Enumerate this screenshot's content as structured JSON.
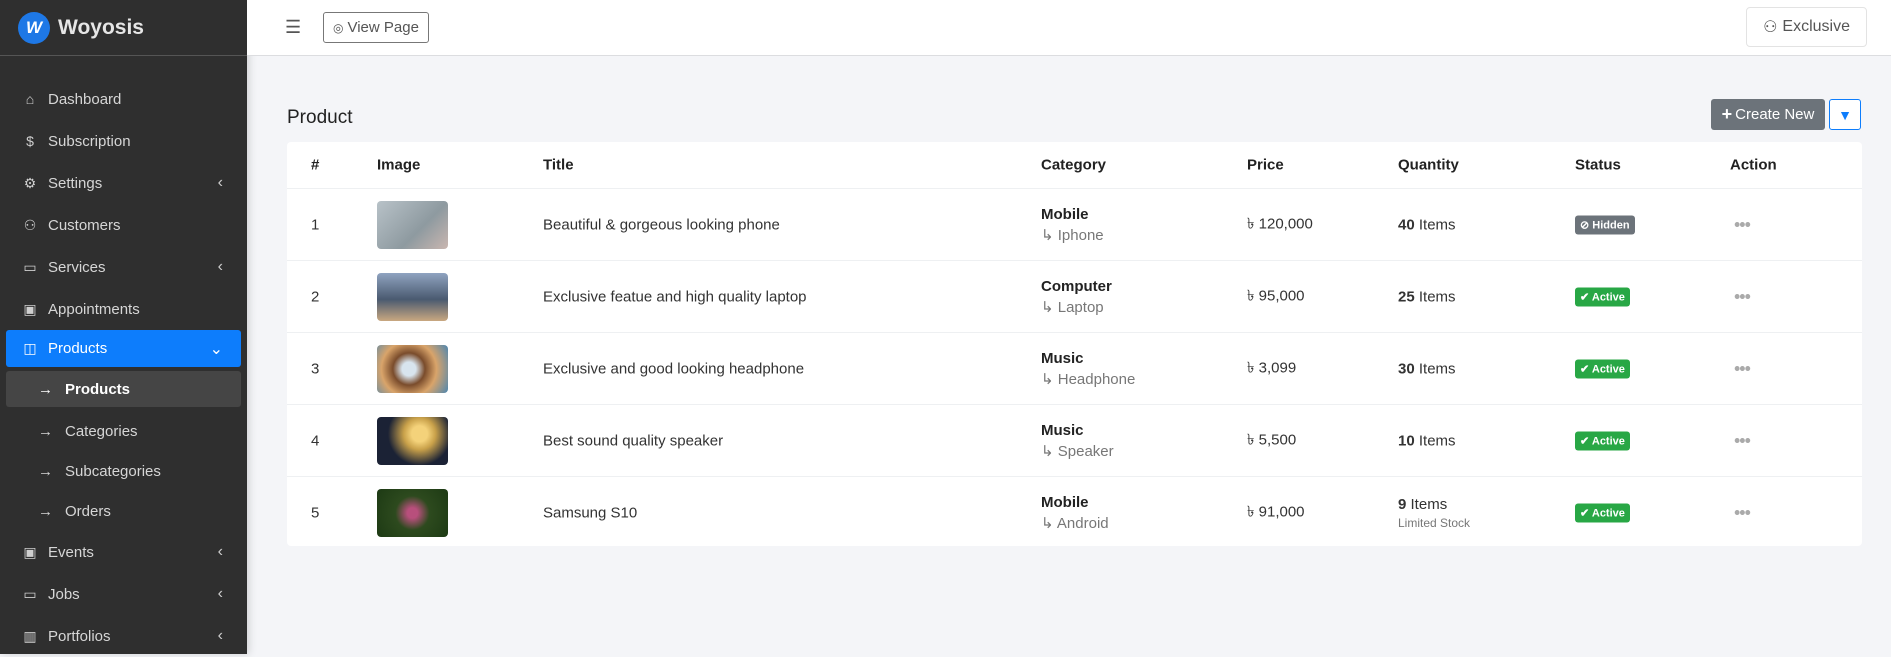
{
  "brand": {
    "name": "Woyosis",
    "logo_letter": "W"
  },
  "sidebar": {
    "items": [
      {
        "label": "Dashboard",
        "icon": "home-icon"
      },
      {
        "label": "Subscription",
        "icon": "dollar-icon"
      },
      {
        "label": "Settings",
        "icon": "gear-icon",
        "expandable": true
      },
      {
        "label": "Customers",
        "icon": "user-icon"
      },
      {
        "label": "Services",
        "icon": "briefcase-icon",
        "expandable": true
      },
      {
        "label": "Appointments",
        "icon": "calendar-icon"
      },
      {
        "label": "Products",
        "icon": "bag-icon",
        "active": true
      },
      {
        "label": "Events",
        "icon": "calendar-icon",
        "expandable": true
      },
      {
        "label": "Jobs",
        "icon": "briefcase-icon",
        "expandable": true
      },
      {
        "label": "Portfolios",
        "icon": "portfolio-icon",
        "expandable": true
      }
    ],
    "products_sub": [
      "Products",
      "Categories",
      "Subcategories",
      "Orders"
    ]
  },
  "topbar": {
    "view_page": "View Page",
    "user": "Exclusive"
  },
  "page": {
    "title": "Product",
    "create_new": "Create New"
  },
  "table": {
    "headers": [
      "#",
      "Image",
      "Title",
      "Category",
      "Price",
      "Quantity",
      "Status",
      "Action"
    ],
    "rows": [
      {
        "n": "1",
        "title": "Beautiful & gorgeous looking phone",
        "category": "Mobile",
        "subcategory": "Iphone",
        "price": "৳ 120,000",
        "qty": "40",
        "qty_unit": "Items",
        "note": "",
        "status": "Hidden"
      },
      {
        "n": "2",
        "title": "Exclusive featue and high quality laptop",
        "category": "Computer",
        "subcategory": "Laptop",
        "price": "৳ 95,000",
        "qty": "25",
        "qty_unit": "Items",
        "note": "",
        "status": "Active"
      },
      {
        "n": "3",
        "title": "Exclusive and good looking headphone",
        "category": "Music",
        "subcategory": "Headphone",
        "price": "৳ 3,099",
        "qty": "30",
        "qty_unit": "Items",
        "note": "",
        "status": "Active"
      },
      {
        "n": "4",
        "title": "Best sound quality speaker",
        "category": "Music",
        "subcategory": "Speaker",
        "price": "৳ 5,500",
        "qty": "10",
        "qty_unit": "Items",
        "note": "",
        "status": "Active"
      },
      {
        "n": "5",
        "title": "Samsung S10",
        "category": "Mobile",
        "subcategory": "Android",
        "price": "৳ 91,000",
        "qty": "9",
        "qty_unit": "Items",
        "note": "Limited Stock",
        "status": "Active"
      }
    ]
  },
  "colors": {
    "primary": "#0d7dfc",
    "active": "#28a745",
    "hidden": "#6c737a",
    "sidebar": "#2f2f2f"
  }
}
